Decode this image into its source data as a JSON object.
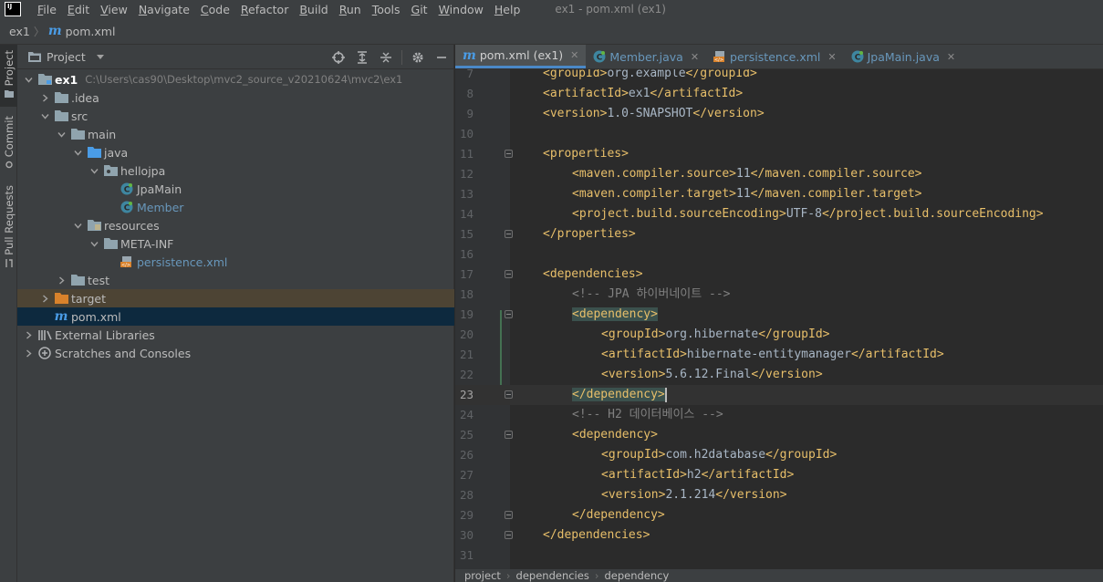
{
  "menubar": {
    "logo": "IJ",
    "items": [
      {
        "underline": "F",
        "rest": "ile"
      },
      {
        "underline": "E",
        "rest": "dit"
      },
      {
        "underline": "V",
        "rest": "iew"
      },
      {
        "underline": "N",
        "rest": "avigate"
      },
      {
        "underline": "C",
        "rest": "ode"
      },
      {
        "underline": "R",
        "rest": "efactor"
      },
      {
        "underline": "B",
        "rest": "uild"
      },
      {
        "underline": "R",
        "rest": "un"
      },
      {
        "underline": "T",
        "rest": "ools"
      },
      {
        "underline": "G",
        "rest": "it"
      },
      {
        "underline": "W",
        "rest": "indow"
      },
      {
        "underline": "H",
        "rest": "elp"
      }
    ],
    "window_title": "ex1 - pom.xml (ex1)"
  },
  "navbar": {
    "project": "ex1",
    "file": "pom.xml",
    "file_icon": "m-icon"
  },
  "stripe": {
    "project": "Project",
    "commit": "Commit",
    "pull_requests": "Pull Requests"
  },
  "project_panel": {
    "title": "Project",
    "tree": [
      {
        "label": "ex1",
        "path": "C:\\Users\\cas90\\Desktop\\mvc2_source_v20210624\\mvc2\\ex1",
        "icon": "folder-module-icon",
        "caret": "down",
        "depth": 0,
        "style": "root"
      },
      {
        "label": ".idea",
        "icon": "folder-icon",
        "caret": "right",
        "depth": 1
      },
      {
        "label": "src",
        "icon": "folder-icon",
        "caret": "down",
        "depth": 1
      },
      {
        "label": "main",
        "icon": "folder-icon",
        "caret": "down",
        "depth": 2
      },
      {
        "label": "java",
        "icon": "folder-source-icon",
        "caret": "down",
        "depth": 3
      },
      {
        "label": "hellojpa",
        "icon": "package-icon",
        "caret": "down",
        "depth": 4
      },
      {
        "label": "JpaMain",
        "icon": "class-icon",
        "caret": "",
        "depth": 5
      },
      {
        "label": "Member",
        "icon": "class-icon",
        "caret": "",
        "depth": 5,
        "style": "blue"
      },
      {
        "label": "resources",
        "icon": "folder-resources-icon",
        "caret": "down",
        "depth": 3
      },
      {
        "label": "META-INF",
        "icon": "folder-icon",
        "caret": "down",
        "depth": 4
      },
      {
        "label": "persistence.xml",
        "icon": "xml-file-icon",
        "caret": "",
        "depth": 5,
        "style": "blue"
      },
      {
        "label": "test",
        "icon": "folder-icon",
        "caret": "right",
        "depth": 2
      },
      {
        "label": "target",
        "icon": "folder-excluded-icon",
        "caret": "right",
        "depth": 1,
        "style": "target"
      },
      {
        "label": "pom.xml",
        "icon": "maven-file-icon",
        "caret": "",
        "depth": 1,
        "style": "selected"
      },
      {
        "label": "External Libraries",
        "icon": "libraries-icon",
        "caret": "right",
        "depth": 0
      },
      {
        "label": "Scratches and Consoles",
        "icon": "scratches-icon",
        "caret": "right",
        "depth": 0
      }
    ]
  },
  "editor": {
    "tabs": [
      {
        "label": "pom.xml (ex1)",
        "icon": "maven-file-icon",
        "active": true
      },
      {
        "label": "Member.java",
        "icon": "class-icon",
        "active": false
      },
      {
        "label": "persistence.xml",
        "icon": "xml-file-icon",
        "active": false
      },
      {
        "label": "JpaMain.java",
        "icon": "class-icon",
        "active": false
      }
    ],
    "current_line": 23,
    "lines": [
      {
        "n": "7",
        "indent": 1,
        "parts": [
          [
            "tag",
            "<groupId>"
          ],
          [
            "val",
            "org.example"
          ],
          [
            "tag",
            "</groupId>"
          ]
        ]
      },
      {
        "n": "8",
        "indent": 1,
        "parts": [
          [
            "tag",
            "<artifactId>"
          ],
          [
            "val",
            "ex1"
          ],
          [
            "tag",
            "</artifactId>"
          ]
        ]
      },
      {
        "n": "9",
        "indent": 1,
        "parts": [
          [
            "tag",
            "<version>"
          ],
          [
            "val",
            "1.0-SNAPSHOT"
          ],
          [
            "tag",
            "</version>"
          ]
        ]
      },
      {
        "n": "10",
        "indent": 0,
        "parts": []
      },
      {
        "n": "11",
        "indent": 1,
        "fold": true,
        "parts": [
          [
            "tag",
            "<properties>"
          ]
        ]
      },
      {
        "n": "12",
        "indent": 2,
        "parts": [
          [
            "tag",
            "<maven.compiler.source>"
          ],
          [
            "val",
            "11"
          ],
          [
            "tag",
            "</maven.compiler.source>"
          ]
        ]
      },
      {
        "n": "13",
        "indent": 2,
        "parts": [
          [
            "tag",
            "<maven.compiler.target>"
          ],
          [
            "val",
            "11"
          ],
          [
            "tag",
            "</maven.compiler.target>"
          ]
        ]
      },
      {
        "n": "14",
        "indent": 2,
        "parts": [
          [
            "tag",
            "<project.build.sourceEncoding>"
          ],
          [
            "val",
            "UTF-8"
          ],
          [
            "tag",
            "</project.build.sourceEncoding>"
          ]
        ]
      },
      {
        "n": "15",
        "indent": 1,
        "fold": true,
        "parts": [
          [
            "tag",
            "</properties>"
          ]
        ]
      },
      {
        "n": "16",
        "indent": 0,
        "parts": []
      },
      {
        "n": "17",
        "indent": 1,
        "fold": true,
        "parts": [
          [
            "tag",
            "<dependencies>"
          ]
        ]
      },
      {
        "n": "18",
        "indent": 2,
        "parts": [
          [
            "cmt",
            "<!-- JPA 하이버네이트 -->"
          ]
        ]
      },
      {
        "n": "19",
        "indent": 2,
        "fold": true,
        "parts": [
          [
            "tag hl",
            "<dependency>"
          ]
        ]
      },
      {
        "n": "20",
        "indent": 3,
        "parts": [
          [
            "tag",
            "<groupId>"
          ],
          [
            "val",
            "org.hibernate"
          ],
          [
            "tag",
            "</groupId>"
          ]
        ]
      },
      {
        "n": "21",
        "indent": 3,
        "parts": [
          [
            "tag",
            "<artifactId>"
          ],
          [
            "val",
            "hibernate-entitymanager"
          ],
          [
            "tag",
            "</artifactId>"
          ]
        ]
      },
      {
        "n": "22",
        "indent": 3,
        "parts": [
          [
            "tag",
            "<version>"
          ],
          [
            "val",
            "5.6.12.Final"
          ],
          [
            "tag",
            "</version>"
          ]
        ]
      },
      {
        "n": "23",
        "indent": 2,
        "fold": true,
        "caret": true,
        "parts": [
          [
            "tag hl",
            "</dependency>"
          ]
        ]
      },
      {
        "n": "24",
        "indent": 2,
        "parts": [
          [
            "cmt",
            "<!-- H2 데이터베이스 -->"
          ]
        ]
      },
      {
        "n": "25",
        "indent": 2,
        "fold": true,
        "parts": [
          [
            "tag",
            "<dependency>"
          ]
        ]
      },
      {
        "n": "26",
        "indent": 3,
        "parts": [
          [
            "tag",
            "<groupId>"
          ],
          [
            "val",
            "com.h2database"
          ],
          [
            "tag",
            "</groupId>"
          ]
        ]
      },
      {
        "n": "27",
        "indent": 3,
        "parts": [
          [
            "tag",
            "<artifactId>"
          ],
          [
            "val",
            "h2"
          ],
          [
            "tag",
            "</artifactId>"
          ]
        ]
      },
      {
        "n": "28",
        "indent": 3,
        "parts": [
          [
            "tag",
            "<version>"
          ],
          [
            "val",
            "2.1.214"
          ],
          [
            "tag",
            "</version>"
          ]
        ]
      },
      {
        "n": "29",
        "indent": 2,
        "fold": true,
        "parts": [
          [
            "tag",
            "</dependency>"
          ]
        ]
      },
      {
        "n": "30",
        "indent": 1,
        "fold": true,
        "parts": [
          [
            "tag",
            "</dependencies>"
          ]
        ]
      },
      {
        "n": "31",
        "indent": 0,
        "parts": []
      }
    ],
    "breadcrumb": [
      "project",
      "dependencies",
      "dependency"
    ]
  },
  "colors": {
    "background": "#2b2b2b",
    "panel": "#3c3f41",
    "xml_tag": "#e8bf6a",
    "comment": "#808080",
    "selection": "#0d293e",
    "accent": "#4a88c7"
  }
}
